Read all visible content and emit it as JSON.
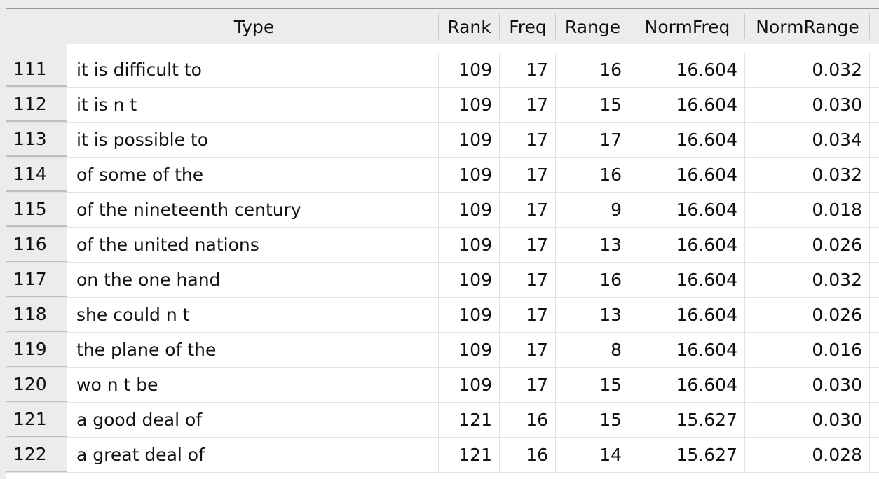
{
  "columns": [
    "",
    "Type",
    "Rank",
    "Freq",
    "Range",
    "NormFreq",
    "NormRange"
  ],
  "rows": [
    {
      "id": "111",
      "type": "it is difficult to",
      "rank": "109",
      "freq": "17",
      "range": "16",
      "normfreq": "16.604",
      "normrange": "0.032"
    },
    {
      "id": "112",
      "type": "it is n t",
      "rank": "109",
      "freq": "17",
      "range": "15",
      "normfreq": "16.604",
      "normrange": "0.030"
    },
    {
      "id": "113",
      "type": "it is possible to",
      "rank": "109",
      "freq": "17",
      "range": "17",
      "normfreq": "16.604",
      "normrange": "0.034"
    },
    {
      "id": "114",
      "type": "of some of the",
      "rank": "109",
      "freq": "17",
      "range": "16",
      "normfreq": "16.604",
      "normrange": "0.032"
    },
    {
      "id": "115",
      "type": "of the nineteenth century",
      "rank": "109",
      "freq": "17",
      "range": "9",
      "normfreq": "16.604",
      "normrange": "0.018"
    },
    {
      "id": "116",
      "type": "of the united nations",
      "rank": "109",
      "freq": "17",
      "range": "13",
      "normfreq": "16.604",
      "normrange": "0.026"
    },
    {
      "id": "117",
      "type": "on the one hand",
      "rank": "109",
      "freq": "17",
      "range": "16",
      "normfreq": "16.604",
      "normrange": "0.032"
    },
    {
      "id": "118",
      "type": "she could n t",
      "rank": "109",
      "freq": "17",
      "range": "13",
      "normfreq": "16.604",
      "normrange": "0.026"
    },
    {
      "id": "119",
      "type": "the plane of the",
      "rank": "109",
      "freq": "17",
      "range": "8",
      "normfreq": "16.604",
      "normrange": "0.016"
    },
    {
      "id": "120",
      "type": "wo n t be",
      "rank": "109",
      "freq": "17",
      "range": "15",
      "normfreq": "16.604",
      "normrange": "0.030"
    },
    {
      "id": "121",
      "type": "a good deal of",
      "rank": "121",
      "freq": "16",
      "range": "15",
      "normfreq": "15.627",
      "normrange": "0.030"
    },
    {
      "id": "122",
      "type": "a great deal of",
      "rank": "121",
      "freq": "16",
      "range": "14",
      "normfreq": "15.627",
      "normrange": "0.028"
    }
  ]
}
